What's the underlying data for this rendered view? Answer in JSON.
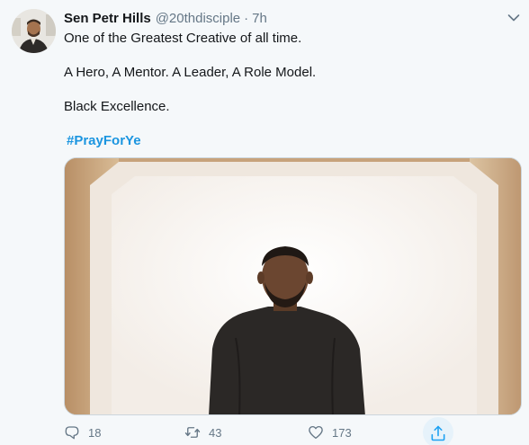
{
  "tweet": {
    "author_name": "Sen Petr Hills",
    "handle": "@20thdisciple",
    "separator": "·",
    "time": "7h",
    "lines": [
      "One of the Greatest Creative of all time.",
      "A Hero, A Mentor. A Leader, A Role Model.",
      "Black Excellence."
    ],
    "hashtag": "#PrayForYe"
  },
  "actions": {
    "replies": "18",
    "retweets": "43",
    "likes": "173"
  },
  "icons": {
    "caret": "chevron-down-icon",
    "reply": "reply-icon",
    "retweet": "retweet-icon",
    "like": "heart-icon",
    "share": "share-icon"
  },
  "colors": {
    "background": "#f5f8fa",
    "text": "#14171a",
    "secondary": "#657786",
    "link": "#1b95e0",
    "share_highlight": "#e6f2fa"
  }
}
